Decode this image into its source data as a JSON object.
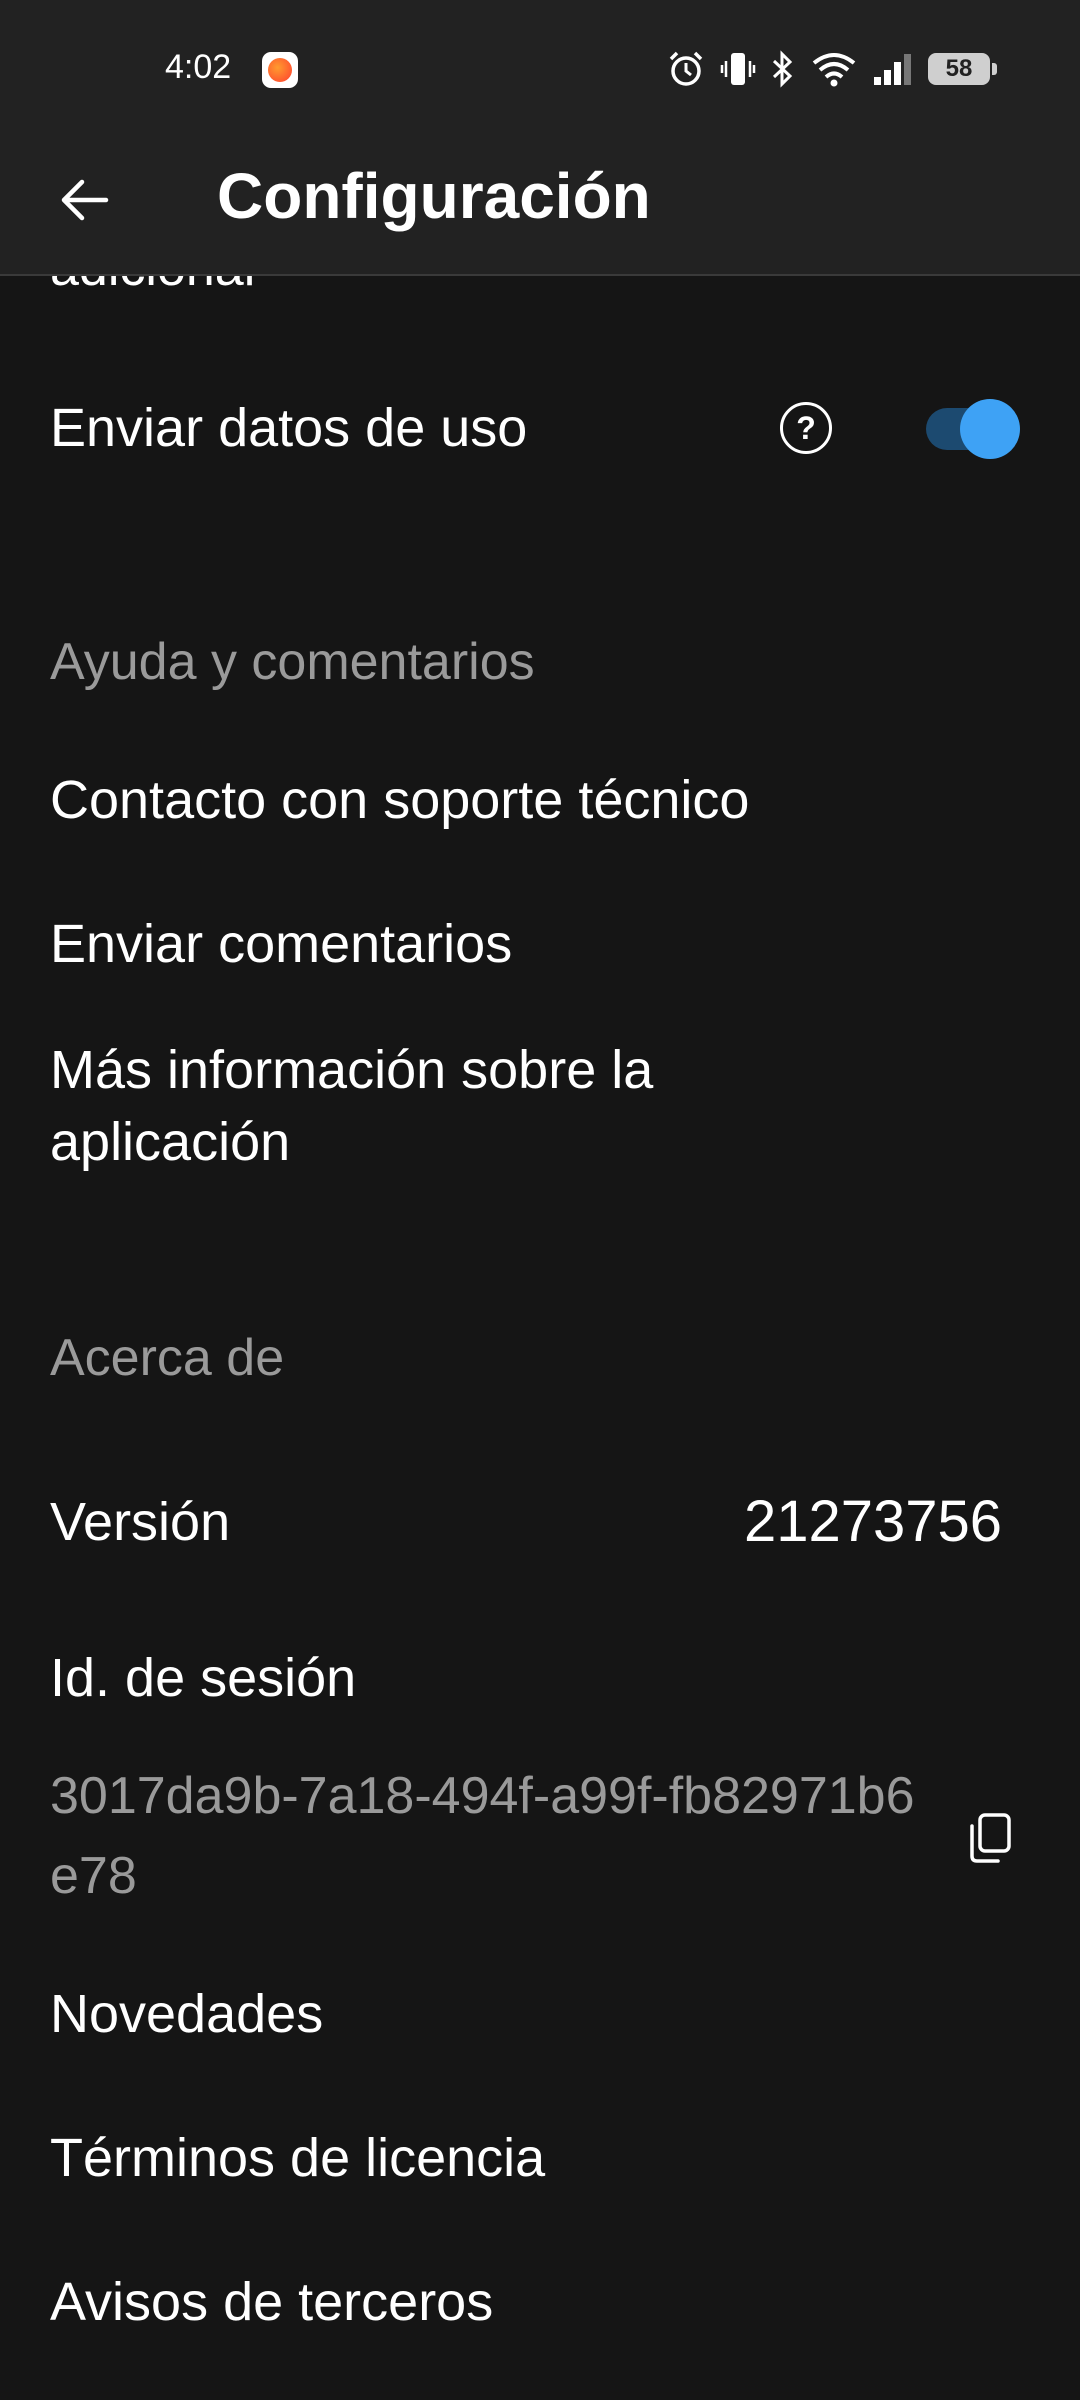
{
  "status_bar": {
    "time": "4:02",
    "battery": "58",
    "icons": [
      "app-notification-icon",
      "alarm-icon",
      "vibrate-icon",
      "bluetooth-icon",
      "wifi-icon",
      "signal-icon",
      "battery-icon"
    ]
  },
  "app_bar": {
    "title": "Configuración",
    "back_icon": "arrow-left-icon"
  },
  "content": {
    "partial_item": "adicional",
    "usage_data": {
      "label": "Enviar datos de uso",
      "help_icon": "help-circle-icon",
      "toggle_on": true,
      "toggle_color": "#3ea2f5"
    },
    "help_section": {
      "header": "Ayuda y comentarios",
      "items": [
        "Contacto con soporte técnico",
        "Enviar comentarios",
        "Más información sobre la aplicación"
      ]
    },
    "about_section": {
      "header": "Acerca de",
      "version_label": "Versión",
      "version_value": "21273756",
      "session_label": "Id. de sesión",
      "session_id": "3017da9b-7a18-494f-a99f-fb82971b6e78",
      "copy_icon": "copy-icon",
      "items": [
        "Novedades",
        "Términos de licencia",
        "Avisos de terceros"
      ]
    }
  },
  "colors": {
    "background": "#151515",
    "app_bar": "#222222",
    "secondary_text": "#9a9a9a",
    "accent": "#3ea2f5"
  }
}
